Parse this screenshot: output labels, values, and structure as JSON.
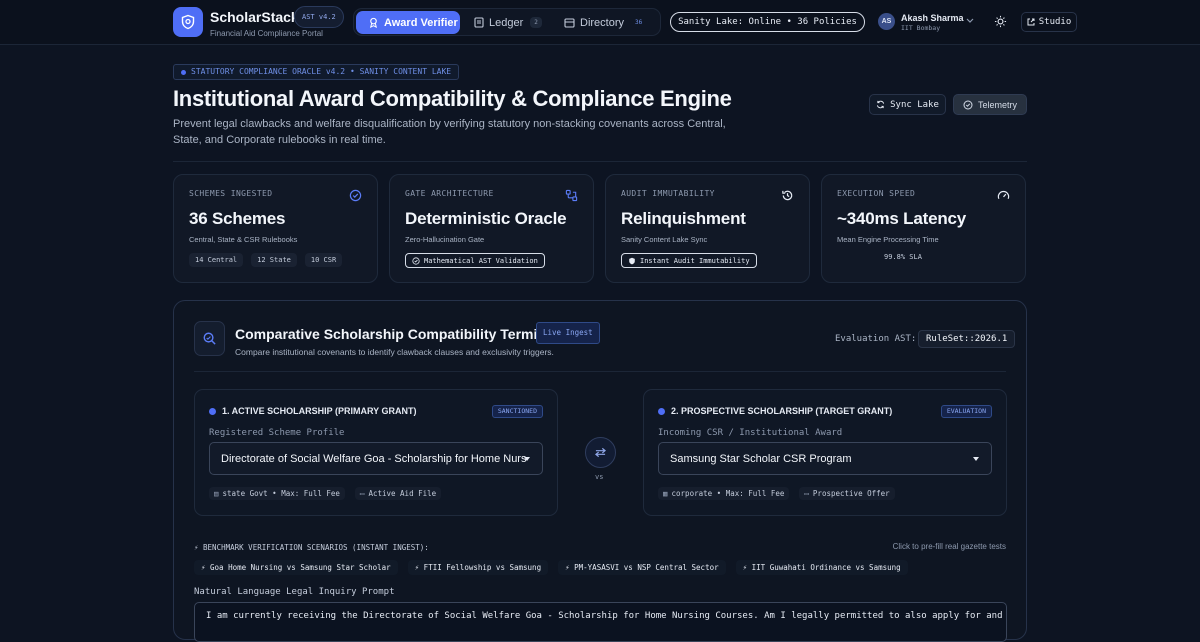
{
  "header": {
    "brand": "ScholarStack",
    "brand_sub": "Financial Aid Compliance Portal",
    "ast_version": "AST v4.2",
    "nav": [
      {
        "label": "Award Verifier",
        "badge": ""
      },
      {
        "label": "Ledger",
        "badge": "2"
      },
      {
        "label": "Directory",
        "badge": "36"
      }
    ],
    "status": "Sanity Lake: Online • 36 Policies",
    "user": {
      "initials": "AS",
      "name": "Akash Sharma",
      "institution": "IIT Bombay"
    },
    "studio_label": "Studio"
  },
  "hero": {
    "oracle_tag": "STATUTORY COMPLIANCE ORACLE v4.2 • SANITY CONTENT LAKE",
    "title": "Institutional Award Compatibility & Compliance Engine",
    "description": "Prevent legal clawbacks and welfare disqualification by verifying statutory non-stacking covenants across Central, State, and Corporate rulebooks in real time.",
    "sync_label": "Sync Lake",
    "telemetry_label": "Telemetry"
  },
  "cards": [
    {
      "label": "SCHEMES INGESTED",
      "value": "36 Schemes",
      "sub": "Central, State & CSR Rulebooks",
      "chips": [
        "14 Central",
        "12 State",
        "10 CSR"
      ],
      "icon": "check-circle-icon"
    },
    {
      "label": "GATE ARCHITECTURE",
      "value": "Deterministic Oracle",
      "sub": "Zero-Hallucination Gate",
      "chip": "Mathematical AST Validation",
      "icon": "workflow-icon"
    },
    {
      "label": "AUDIT IMMUTABILITY",
      "value": "Relinquishment",
      "sub": "Sanity Content Lake Sync",
      "chip": "Instant Audit Immutability",
      "icon": "history-icon"
    },
    {
      "label": "EXECUTION SPEED",
      "value": "~340ms Latency",
      "sub": "Mean Engine Processing Time",
      "sla": "99.8% SLA",
      "icon": "gauge-icon"
    }
  ],
  "terminal": {
    "title": "Comparative Scholarship Compatibility Terminal",
    "live_badge": "Live Ingest",
    "subtitle": "Compare institutional covenants to identify clawback clauses and exclusivity triggers.",
    "eval_label": "Evaluation AST:",
    "eval_value": "RuleSet::2026.1",
    "active": {
      "heading": "1. ACTIVE SCHOLARSHIP (PRIMARY GRANT)",
      "badge": "SANCTIONED",
      "field_label": "Registered Scheme Profile",
      "selected": "Directorate of Social Welfare Goa - Scholarship for Home Nurs",
      "tags": [
        "state Govt • Max: Full Fee",
        "Active Aid File"
      ]
    },
    "vs_label": "vs",
    "prospective": {
      "heading": "2. PROSPECTIVE SCHOLARSHIP (TARGET GRANT)",
      "badge": "EVALUATION",
      "field_label": "Incoming CSR / Institutional Award",
      "selected": "Samsung Star Scholar CSR Program",
      "tags": [
        "corporate • Max: Full Fee",
        "Prospective Offer"
      ]
    },
    "bench_label": "⚡ BENCHMARK VERIFICATION SCENARIOS (INSTANT INGEST):",
    "bench_hint": "Click to pre-fill real gazette tests",
    "benchmarks": [
      "⚡ Goa Home Nursing vs Samsung Star Scholar",
      "⚡ FTII Fellowship vs Samsung",
      "⚡ PM-YASASVI vs NSP Central Sector",
      "⚡ IIT Guwahati Ordinance vs Samsung"
    ],
    "prompt_label": "Natural Language Legal Inquiry Prompt",
    "prompt_text": "I am currently receiving the Directorate of Social Welfare Goa - Scholarship for Home Nursing Courses. Am I legally permitted to also apply for and accept"
  },
  "colors": {
    "accent": "#4f6ef6",
    "background": "#0d1422"
  }
}
